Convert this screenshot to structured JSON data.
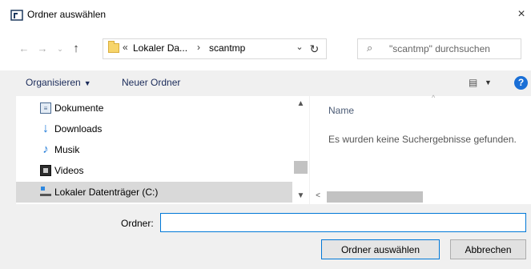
{
  "window": {
    "title": "Ordner auswählen",
    "close_glyph": "×"
  },
  "nav_buttons": {
    "back_glyph": "←",
    "forward_glyph": "→",
    "recent_glyph": "⌄",
    "up_glyph": "↑"
  },
  "address": {
    "overflow_chevron": "«",
    "crumb_1": "Lokaler Da...",
    "separator": "›",
    "crumb_2": "scantmp",
    "dropdown_glyph": "⌄",
    "refresh_glyph": "↻"
  },
  "search": {
    "icon_glyph": "⌕",
    "placeholder": "\"scantmp\" durchsuchen"
  },
  "toolbar": {
    "organize_label": "Organisieren",
    "organize_caret": "▼",
    "new_folder_label": "Neuer Ordner",
    "view_glyph": "▤",
    "view_caret": "▼",
    "help_glyph": "?"
  },
  "nav_pane": {
    "items": [
      {
        "label": "Dokumente",
        "icon": "document-icon",
        "glyph": "≡"
      },
      {
        "label": "Downloads",
        "icon": "download-icon",
        "glyph": "↓"
      },
      {
        "label": "Musik",
        "icon": "music-icon",
        "glyph": "♪"
      },
      {
        "label": "Videos",
        "icon": "video-icon",
        "glyph": ""
      },
      {
        "label": "Lokaler Datenträger (C:)",
        "icon": "drive-icon",
        "glyph": ""
      }
    ],
    "selected_index": 4,
    "scroll_up_glyph": "▲",
    "scroll_down_glyph": "▼"
  },
  "file_pane": {
    "sort_glyph": "^",
    "column_name": "Name",
    "empty_message": "Es wurden keine Suchergebnisse gefunden.",
    "scroll_left_glyph": "<"
  },
  "footer": {
    "folder_label": "Ordner:",
    "folder_value": "",
    "select_button": "Ordner auswählen",
    "cancel_button": "Abbrechen"
  },
  "colors": {
    "accent": "#0078d7",
    "help": "#1a6fd6",
    "selection": "#d9d9d9"
  }
}
